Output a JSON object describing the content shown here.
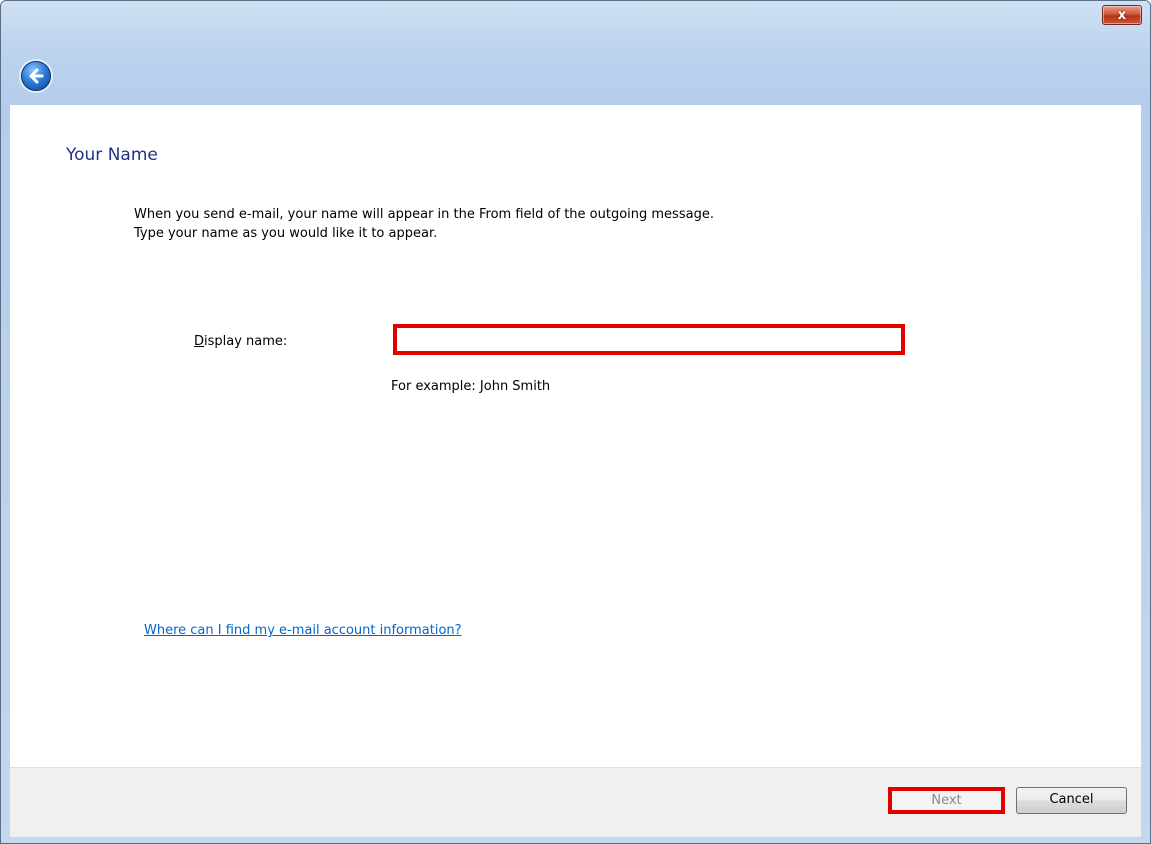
{
  "window": {
    "close_symbol": "x",
    "back_icon": "back-arrow-icon"
  },
  "page": {
    "title": "Your Name",
    "description_line1": "When you send e-mail, your name will appear in the From field of the outgoing message.",
    "description_line2": "Type your name as you would like it to appear."
  },
  "form": {
    "display_name_label_accesskey": "D",
    "display_name_label_rest": "isplay name:",
    "display_name_value": "",
    "example_text": "For example: John Smith"
  },
  "help": {
    "link_text": "Where can I find my e-mail account information?"
  },
  "footer": {
    "next_label": "Next",
    "cancel_label": "Cancel"
  },
  "colors": {
    "title_text": "#1e3287",
    "link": "#0066cc",
    "highlight": "#e00000"
  }
}
